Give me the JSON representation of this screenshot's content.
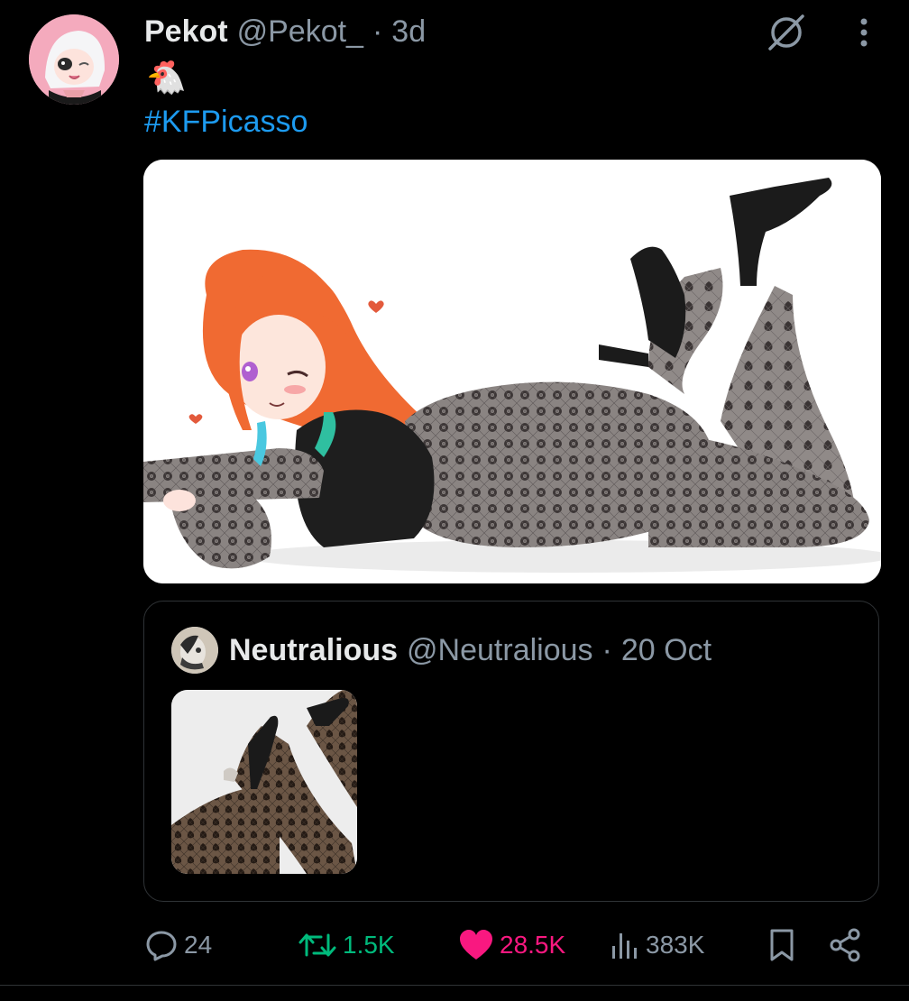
{
  "tweet": {
    "author_name": "Pekot",
    "author_handle": "@Pekot_",
    "separator": "·",
    "time": "3d",
    "emoji": "🐔",
    "hashtag": "#KFPicasso"
  },
  "quote": {
    "author_name": "Neutralious",
    "author_handle": "@Neutralious",
    "separator": "·",
    "date": "20 Oct"
  },
  "actions": {
    "replies": "24",
    "reposts": "1.5K",
    "likes": "28.5K",
    "views": "383K"
  },
  "icons": {
    "grok": "grok-icon",
    "more": "more-vertical-icon",
    "reply": "reply-icon",
    "repost": "repost-icon",
    "like": "heart-icon",
    "views": "views-icon",
    "bookmark": "bookmark-icon",
    "share": "share-icon"
  },
  "colors": {
    "background": "#000000",
    "link": "#1d9bf0",
    "repost": "#00ba7c",
    "like": "#f91880",
    "muted": "#8b98a5"
  }
}
